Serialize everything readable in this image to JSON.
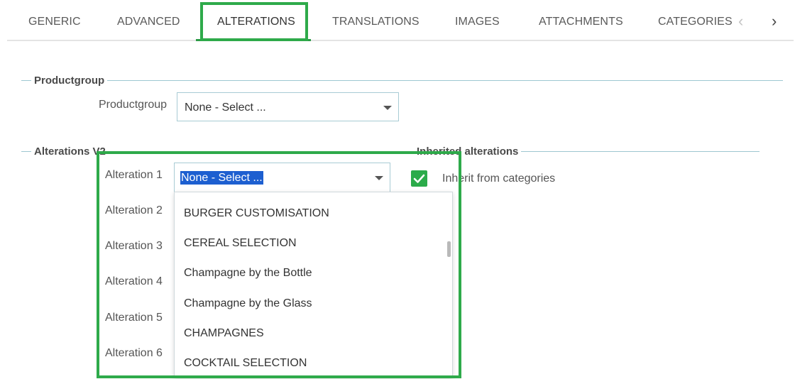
{
  "tabs": [
    {
      "label": "GENERIC"
    },
    {
      "label": "ADVANCED"
    },
    {
      "label": "ALTERATIONS"
    },
    {
      "label": "TRANSLATIONS"
    },
    {
      "label": "IMAGES"
    },
    {
      "label": "ATTACHMENTS"
    },
    {
      "label": "CATEGORIES"
    }
  ],
  "active_tab": "ALTERATIONS",
  "productgroup": {
    "legend": "Productgroup",
    "label": "Productgroup",
    "value": "None - Select ..."
  },
  "alterations": {
    "legend": "Alterations V2",
    "labels": [
      "Alteration 1",
      "Alteration 2",
      "Alteration 3",
      "Alteration 4",
      "Alteration 5",
      "Alteration 6"
    ],
    "alteration1_value": "None - Select ...",
    "dropdown_options": [
      "BURGER CUSTOMISATION",
      "CEREAL SELECTION",
      "Champagne by the Bottle",
      "Champagne by the Glass",
      "CHAMPAGNES",
      "COCKTAIL SELECTION"
    ]
  },
  "inherited": {
    "legend": "Inherited alterations",
    "checkbox_label": "Inherit from categories",
    "checked": true
  },
  "colors": {
    "accent_green": "#2eaa4a",
    "selection_blue": "#1d5fd0",
    "fieldset_line": "#9dc7d1"
  }
}
